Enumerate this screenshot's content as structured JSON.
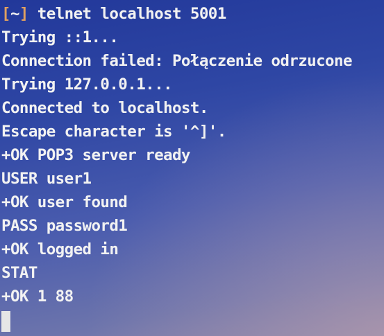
{
  "terminal": {
    "prompt": {
      "open_bracket": "[",
      "path": "~",
      "close_bracket": "]",
      "command": " telnet localhost 5001"
    },
    "output": [
      "Trying ::1...",
      "Connection failed: Połączenie odrzucone",
      "Trying 127.0.0.1...",
      "Connected to localhost.",
      "Escape character is '^]'.",
      "+OK POP3 server ready",
      "USER user1",
      "+OK user found",
      "PASS password1",
      "+OK logged in",
      "STAT",
      "+OK 1 88"
    ],
    "colors": {
      "text": "#f2f2f2",
      "bracket": "#e0a060",
      "cursor": "#e6e6e6"
    }
  }
}
